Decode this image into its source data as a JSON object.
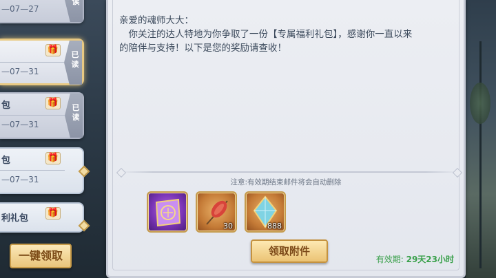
{
  "mail_list": {
    "items": [
      {
        "title": "",
        "date": "—07—27",
        "status": "已读",
        "has_gift": false
      },
      {
        "title": "",
        "date": "—07—31",
        "status": "已读",
        "has_gift": true,
        "selected": true
      },
      {
        "title": "包",
        "date": "—07—31",
        "status": "已读",
        "has_gift": true
      },
      {
        "title": "包",
        "date": "—07—31",
        "status": "",
        "has_gift": true,
        "unread": true
      },
      {
        "title": "利礼包",
        "date": "",
        "status": "",
        "has_gift": true,
        "unread": true
      }
    ],
    "one_click_claim_label": "一键领取"
  },
  "mail": {
    "greeting": "亲爱的魂师大大：",
    "body_line1": "你关注的达人特地为你争取了一份【专属福利礼包】，感谢你一直以来",
    "body_line2": "的陪伴与支持！以下是您的奖励请查收！",
    "notice": "注意:有效期结束邮件将会自动删除",
    "attachments": [
      {
        "name": "purple-scroll",
        "count": ""
      },
      {
        "name": "meat-skewer",
        "count": "30"
      },
      {
        "name": "crystal-shard",
        "count": "888"
      }
    ],
    "claim_label": "领取附件",
    "validity_label": "有效期:",
    "validity_value": "29天23小时"
  },
  "colors": {
    "accent_gold": "#e9c57b",
    "validity_green": "#39a04a",
    "text_main": "#3c4a5c"
  }
}
